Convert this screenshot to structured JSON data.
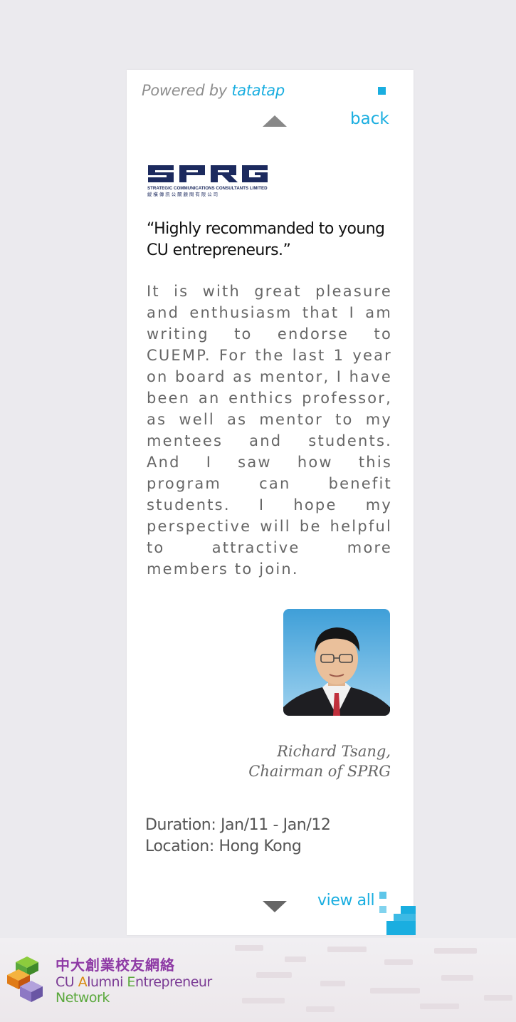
{
  "header": {
    "powered_prefix": "Powered by ",
    "powered_brand": "tatatap",
    "back_label": "back"
  },
  "testimonial": {
    "company_logo_text": "SPRG",
    "company_logo_subtitle": "STRATEGIC COMMUNICATIONS CONSULTANTS LIMITED",
    "company_logo_chinese": "縱 橫 傳 訊 公 關 顧 問 有 限 公 司",
    "quote": "“Highly recommanded to young CU entrepreneurs.”",
    "body": "It is with great pleasure and enthusiasm that I am writing to endorse to CUEMP. For the last 1 year on board as mentor, I have been an enthics professor, as well as mentor to my mentees and students. And I saw how this program can benefit students. I hope my perspective will be helpful to attractive more members to join.",
    "author_name": "Richard Tsang,",
    "author_title": "Chairman of SPRG",
    "duration": "Duration: Jan/11 - Jan/12",
    "location": "Location: Hong Kong"
  },
  "footer_nav": {
    "view_all_label": "view all"
  },
  "footer": {
    "org_chinese": "中大創業校友網絡",
    "org_en_line1_part1": "CU ",
    "org_en_line1_a": "A",
    "org_en_line1_part2": "lumni ",
    "org_en_line1_e": "E",
    "org_en_line1_part3": "ntrepreneur",
    "org_en_line2": "Network"
  },
  "colors": {
    "accent": "#1aaee0",
    "purple": "#8e3aa5",
    "green": "#5aa83c"
  }
}
